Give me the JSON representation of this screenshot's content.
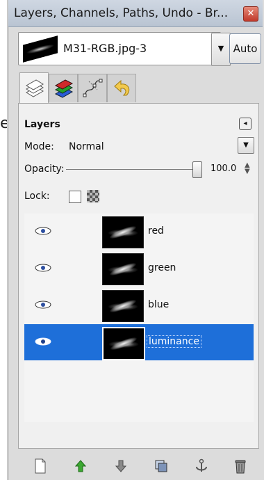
{
  "stray_text": "e",
  "window": {
    "title": "Layers, Channels, Paths, Undo - Br...",
    "close_glyph": "✕"
  },
  "image_selector": {
    "value": "M31-RGB.jpg-3",
    "dropdown_glyph": "▼",
    "auto_label": "Auto"
  },
  "tabs": [
    {
      "name": "layers",
      "icon": "layers-icon",
      "active": true
    },
    {
      "name": "channels",
      "icon": "channels-icon"
    },
    {
      "name": "paths",
      "icon": "paths-icon"
    },
    {
      "name": "undo",
      "icon": "undo-icon"
    }
  ],
  "panel": {
    "title": "Layers",
    "menu_glyph": "◂",
    "mode_label": "Mode:",
    "mode_value": "Normal",
    "mode_dropdown_glyph": "▼",
    "opacity_label": "Opacity:",
    "opacity_value": "100.0",
    "opacity_fraction": 1.0,
    "lock_label": "Lock:"
  },
  "layers": [
    {
      "name": "red",
      "visible": true,
      "selected": false
    },
    {
      "name": "green",
      "visible": true,
      "selected": false
    },
    {
      "name": "blue",
      "visible": true,
      "selected": false
    },
    {
      "name": "luminance",
      "visible": true,
      "selected": true
    }
  ],
  "bottom_toolbar": [
    {
      "icon": "new-layer-icon"
    },
    {
      "icon": "raise-layer-icon"
    },
    {
      "icon": "lower-layer-icon"
    },
    {
      "icon": "duplicate-layer-icon"
    },
    {
      "icon": "anchor-layer-icon"
    },
    {
      "icon": "delete-layer-icon"
    }
  ],
  "colors": {
    "selection": "#1e6fd9",
    "raise_arrow": "#3ca832",
    "lower_arrow": "#7a7a7a"
  }
}
